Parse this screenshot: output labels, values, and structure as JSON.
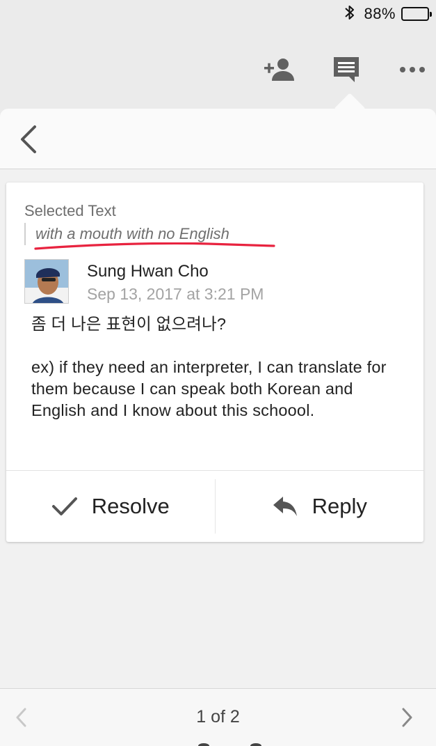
{
  "status_bar": {
    "battery_percent_label": "88%",
    "battery_level": 0.88,
    "bluetooth_icon": "bluetooth-icon"
  },
  "toolbar": {
    "icons": [
      "add-person-icon",
      "comment-icon",
      "more-icon"
    ]
  },
  "panel": {
    "back_icon": "chevron-left-icon"
  },
  "comment": {
    "selected_text_label": "Selected Text",
    "selected_text": "with a mouth with no English",
    "author": "Sung Hwan Cho",
    "timestamp": "Sep 13, 2017 at 3:21 PM",
    "body_line1": "좀 더 나은 표현이 없으려나?",
    "body_line2": "ex) if they need an interpreter, I can translate for them because I can speak both Korean and English and I know about this schoool."
  },
  "actions": {
    "resolve_label": "Resolve",
    "reply_label": "Reply"
  },
  "pager": {
    "text": "1 of 2"
  },
  "colors": {
    "annotation_red": "#e8233f",
    "background": "#ebebeb",
    "card": "#ffffff"
  }
}
